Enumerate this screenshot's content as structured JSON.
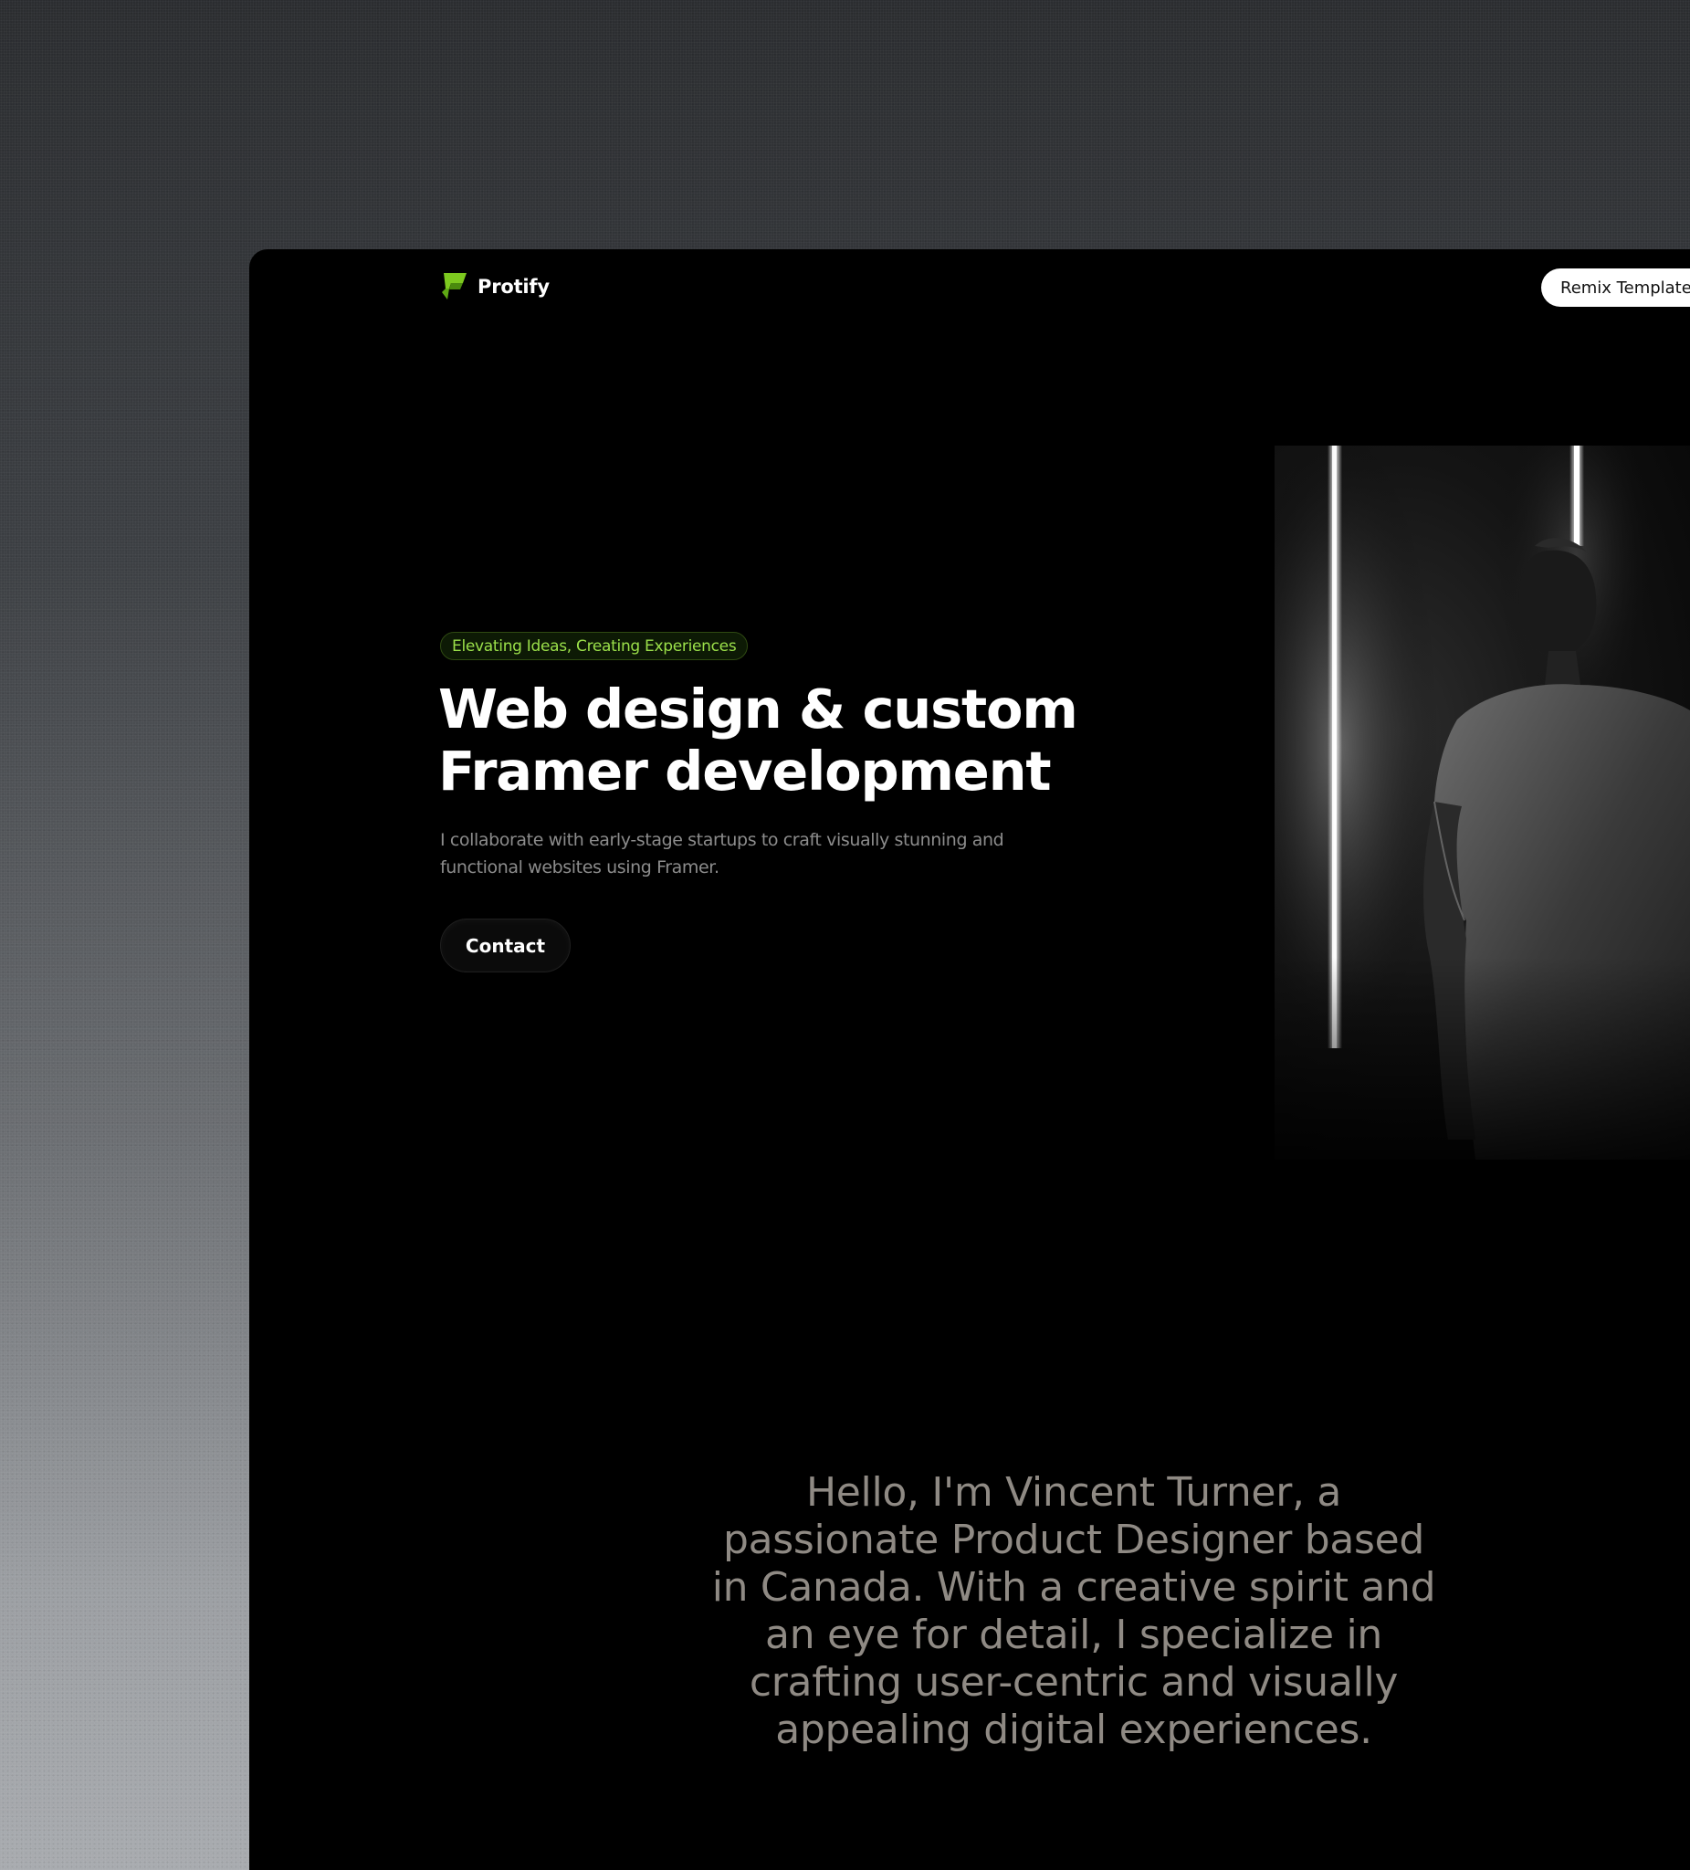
{
  "brand": {
    "name": "Protify",
    "accent_color": "#7dc91f"
  },
  "nav": {
    "remix_label": "Remix Template"
  },
  "hero": {
    "badge": "Elevating Ideas, Creating Experiences",
    "title": "Web design & custom Framer development",
    "description": "I collaborate with early-stage startups to craft visually stunning and functional websites using Framer.",
    "cta_label": "Contact"
  },
  "intro": {
    "text": "Hello, I'm Vincent Turner, a passionate Product Designer based in Canada. With a creative spirit and an eye for detail, I specialize in crafting user-centric and visually appealing digital experiences."
  }
}
